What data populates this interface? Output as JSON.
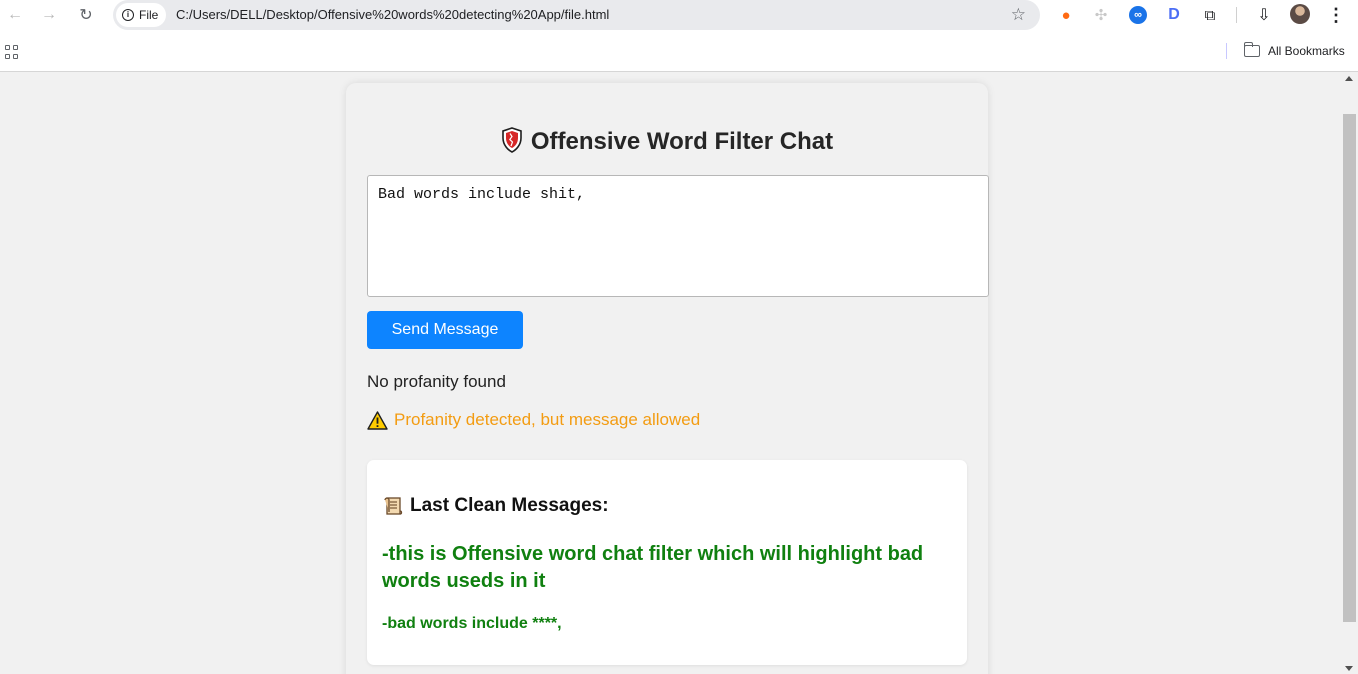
{
  "browser": {
    "url_chip": "File",
    "url": "C:/Users/DELL/Desktop/Offensive%20words%20detecting%20App/file.html",
    "bookmarks_label": "All Bookmarks"
  },
  "app": {
    "title": "Offensive Word Filter Chat",
    "title_icon": "shield-icon",
    "input_value": "Bad words include shit,",
    "send_label": "Send Message",
    "status_clean": "No profanity found",
    "status_warning": "Profanity detected, but message allowed",
    "warning_icon": "warning-icon",
    "warning_color": "#f39c12",
    "history": {
      "heading": "Last Clean Messages:",
      "heading_icon": "scroll-icon",
      "messages": [
        "-this is Offensive word chat filter which will highlight bad words useds in it",
        "-bad words include ****,"
      ],
      "message_color": "#108010"
    },
    "button_color": "#0d84ff"
  }
}
